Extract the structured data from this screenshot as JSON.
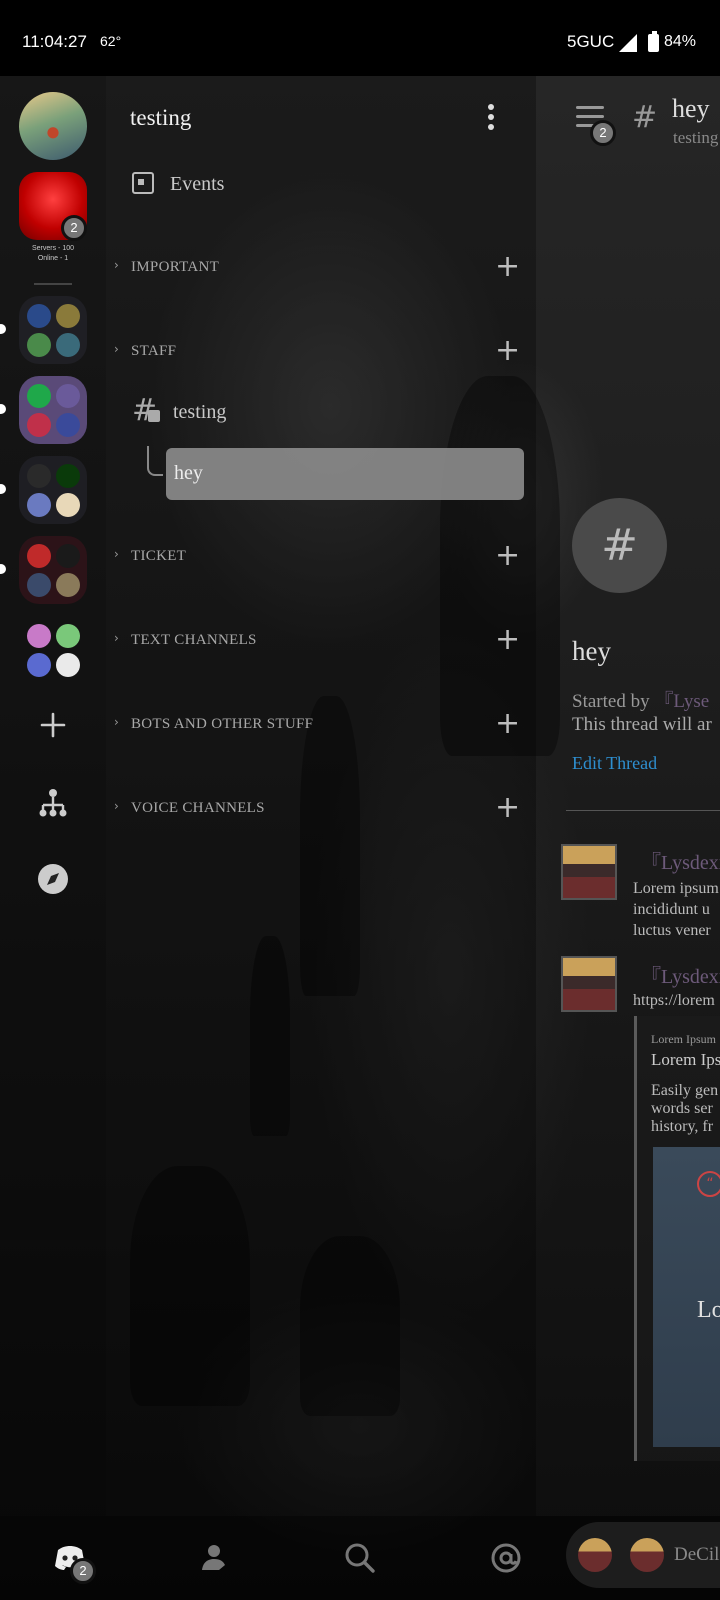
{
  "status_bar": {
    "time": "11:04:27",
    "temperature": "62°",
    "network": "5GUC",
    "battery": "84%"
  },
  "rail": {
    "server_stats": [
      "Servers - 100",
      "Online - 1"
    ],
    "server_badge": "2"
  },
  "server": {
    "name": "testing",
    "events_label": "Events",
    "categories": [
      {
        "label": "IMPORTANT"
      },
      {
        "label": "STAFF"
      },
      {
        "label": "TICKET"
      },
      {
        "label": "TEXT CHANNELS"
      },
      {
        "label": "BOTS AND OTHER STUFF"
      },
      {
        "label": "VOICE CHANNELS"
      }
    ],
    "channel": "testing",
    "thread": "hey"
  },
  "chat": {
    "menu_badge": "2",
    "header_title": "hey",
    "header_subtitle": "testing",
    "thread_title": "hey",
    "started_by_label": "Started by",
    "started_by_user": "『Lyse",
    "archive_text": "This thread will ar",
    "edit_thread": "Edit Thread",
    "messages": [
      {
        "author": "『Lysdexia",
        "lines": [
          "Lorem ipsum",
          "incididunt u",
          "luctus vener"
        ]
      },
      {
        "author": "『Lysdexia",
        "lines": [
          "https://lorem"
        ]
      }
    ],
    "embed": {
      "site": "Lorem Ipsum",
      "title": "Lorem Ips",
      "description": [
        "Easily gen",
        "words ser",
        "history, fr"
      ],
      "image_heading": "Lo"
    }
  },
  "bottom_nav": {
    "home_badge": "2",
    "voice_user": "DeCil"
  },
  "colors": {
    "accent_link": "#2e8fd0",
    "selected_thread_bg": "#8a8a8a",
    "username_color": "#6d5a7a"
  }
}
